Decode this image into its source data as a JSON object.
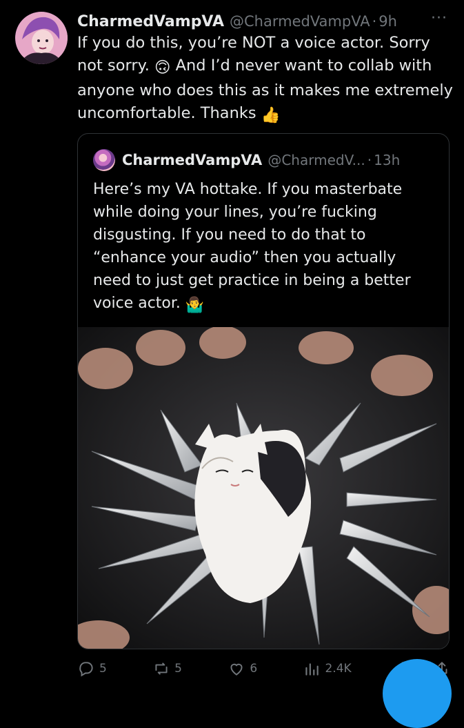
{
  "tweet": {
    "display_name": "CharmedVampVA",
    "handle": "@CharmedVampVA",
    "dot": "·",
    "time": "9h",
    "more": "···",
    "text_1": "If you do this, you’re NOT a voice actor. Sorry not sorry. ",
    "emoji_1": "🙃",
    "text_2": " And I’d never want to collab with anyone who does this as it makes me extremely uncomfortable. Thanks ",
    "emoji_2": "👍"
  },
  "quote": {
    "display_name": "CharmedVampVA",
    "handle": "@CharmedV...",
    "dot": "·",
    "time": "13h",
    "text": "Here’s my VA hottake. If you masterbate while doing your lines, you’re fucking disgusting. If you need to do that to “enhance your audio” then you actually need to just get practice in being a better voice actor. ",
    "emoji": "🤷‍♂️"
  },
  "actions": {
    "replies": "5",
    "reposts": "5",
    "likes": "6",
    "views": "2.4K"
  },
  "colors": {
    "background": "#000000",
    "text": "#e7e9ea",
    "muted": "#71767b",
    "border": "#2f3336",
    "accent": "#1d9bf0"
  }
}
